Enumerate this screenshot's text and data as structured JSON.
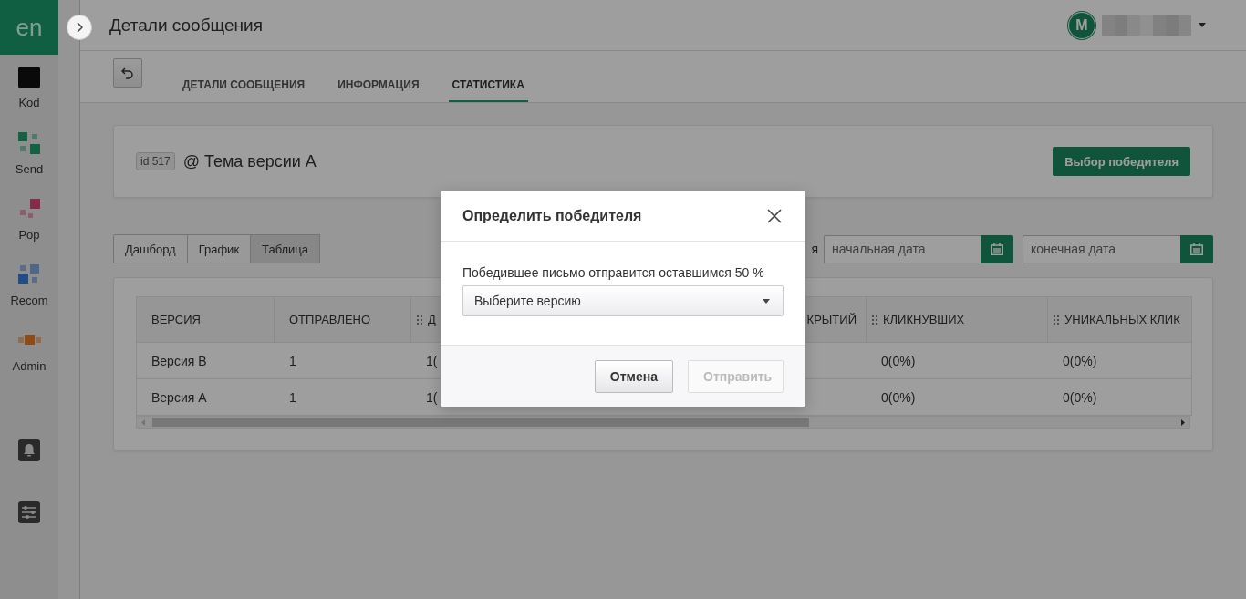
{
  "sidebar": {
    "logo": "en",
    "items": [
      {
        "label": "Kod",
        "kind": "kod"
      },
      {
        "label": "Send",
        "kind": "send"
      },
      {
        "label": "Pop",
        "kind": "pop"
      },
      {
        "label": "Recom",
        "kind": "recom"
      },
      {
        "label": "Admin",
        "kind": "admin"
      }
    ]
  },
  "header": {
    "title": "Детали сообщения",
    "avatar_letter": "M"
  },
  "tabs": [
    {
      "label": "ДЕТАЛИ СООБЩЕНИЯ",
      "selected": false
    },
    {
      "label": "ИНФОРМАЦИЯ",
      "selected": false
    },
    {
      "label": "СТАТИСТИКА",
      "selected": true
    }
  ],
  "message_card": {
    "id_badge": "id 517",
    "subject": "@ Тема версии А",
    "action": "Выбор победителя"
  },
  "view_switch": [
    {
      "label": "Дашборд",
      "selected": false
    },
    {
      "label": "График",
      "selected": false
    },
    {
      "label": "Таблица",
      "selected": true
    }
  ],
  "date_filter": {
    "label": "я",
    "start_placeholder": "начальная дата",
    "end_placeholder": "конечная дата"
  },
  "table": {
    "columns": [
      {
        "label": "ВЕРСИЯ",
        "draggable": false,
        "cells": [
          "Версия В",
          "Версия А"
        ]
      },
      {
        "label": "ОТПРАВЛЕНО",
        "draggable": false,
        "cells": [
          "1",
          "1"
        ]
      },
      {
        "label": "Д",
        "draggable": true,
        "cells": [
          "1(",
          "1("
        ]
      },
      {
        "label": "КРЫТИЙ"
      },
      {
        "label": "КЛИКНУВШИХ",
        "draggable": true,
        "cells": [
          "0(0%)",
          "0(0%)"
        ]
      },
      {
        "label": "УНИКАЛЬНЫХ КЛИК",
        "draggable": true,
        "cells": [
          "0(0%)",
          "0(0%)"
        ]
      }
    ]
  },
  "dialog": {
    "title": "Определить победителя",
    "message": "Победившее письмо отправится оставшимся 50 %",
    "select_placeholder": "Выберите версию",
    "buttons": [
      {
        "label": "Отмена",
        "disabled": false
      },
      {
        "label": "Отправить",
        "disabled": true
      }
    ]
  }
}
